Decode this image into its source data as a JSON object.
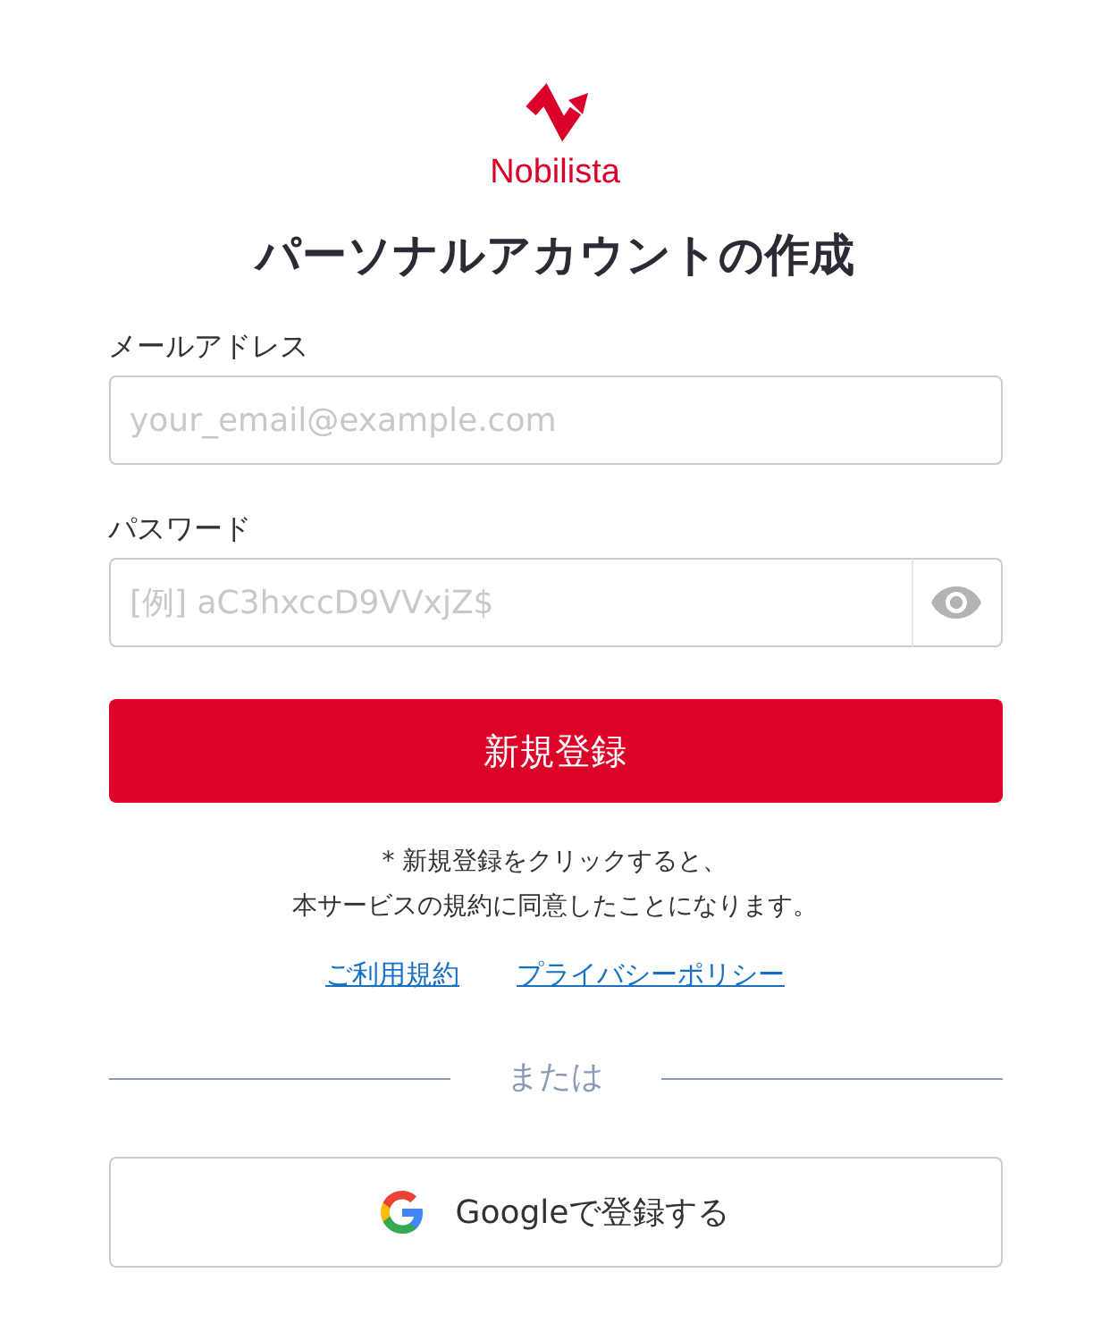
{
  "logo": {
    "name": "Nobilista"
  },
  "title": "パーソナルアカウントの作成",
  "fields": [
    {
      "kind": "email",
      "label": "メールアドレス",
      "placeholder": "your_email@example.com"
    },
    {
      "kind": "password",
      "label": "パスワード",
      "placeholder": "[例] aC3hxccD9VVxjZ$"
    }
  ],
  "submit_button": "新規登録",
  "terms_note": [
    "* 新規登録をクリックすると、",
    "本サービスの規約に同意したことになります。"
  ],
  "links": [
    "ご利用規約",
    "プライバシーポリシー"
  ],
  "divider_text": "または",
  "google_button": "Googleで登録する"
}
